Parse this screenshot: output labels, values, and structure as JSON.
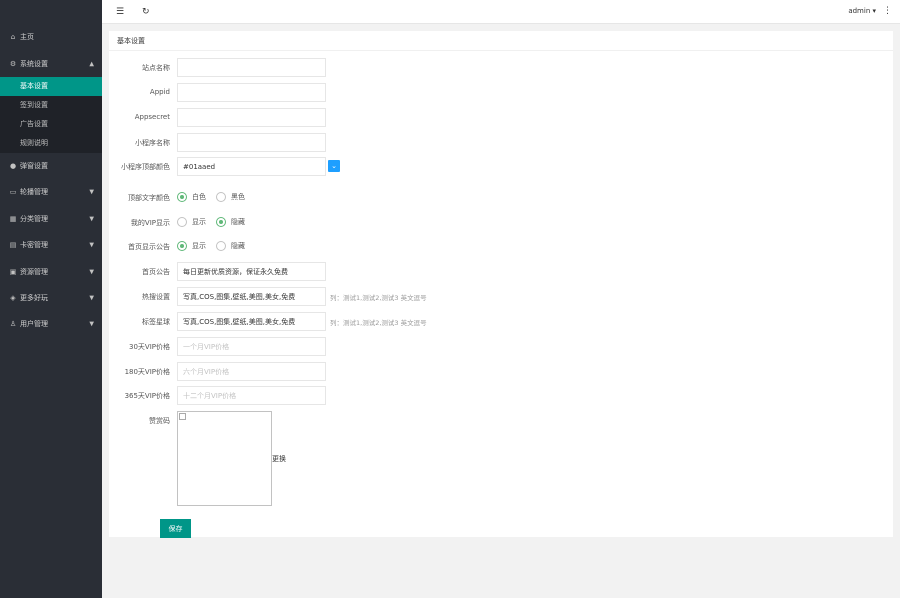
{
  "sidebar": {
    "items": [
      {
        "icon": "home-icon",
        "label": "主页",
        "arrow": ""
      },
      {
        "icon": "gear-icon",
        "label": "系统设置",
        "arrow": "▲"
      },
      {
        "icon": "circle-icon",
        "label": "弹窗设置",
        "arrow": ""
      },
      {
        "icon": "image-icon",
        "label": "轮播管理",
        "arrow": "▼"
      },
      {
        "icon": "category-icon",
        "label": "分类管理",
        "arrow": "▼"
      },
      {
        "icon": "card-icon",
        "label": "卡密管理",
        "arrow": "▼"
      },
      {
        "icon": "resource-icon",
        "label": "资源管理",
        "arrow": "▼"
      },
      {
        "icon": "more-icon",
        "label": "更多好玩",
        "arrow": "▼"
      },
      {
        "icon": "user-icon",
        "label": "用户管理",
        "arrow": "▼"
      }
    ],
    "subitems": [
      "基本设置",
      "签到设置",
      "广告设置",
      "规则说明"
    ]
  },
  "header": {
    "menu_icon": "☰",
    "refresh_icon": "↻",
    "user": "admin ▾",
    "more_icon": "⋮"
  },
  "card": {
    "title": "基本设置",
    "fields": {
      "site_name": {
        "label": "站点名称",
        "value": ""
      },
      "appid": {
        "label": "Appid",
        "value": ""
      },
      "appsecret": {
        "label": "Appsecret",
        "value": ""
      },
      "mini_name": {
        "label": "小程序名称",
        "value": ""
      },
      "top_color": {
        "label": "小程序顶部颜色",
        "value": "#01aaed",
        "color_picker_icon": "⌄"
      },
      "text_color": {
        "label": "顶部文字颜色",
        "options": [
          "白色",
          "黑色"
        ],
        "selected": 0
      },
      "vip_show": {
        "label": "我的VIP显示",
        "options": [
          "显示",
          "隐藏"
        ],
        "selected": 1
      },
      "notice_show": {
        "label": "首页显示公告",
        "options": [
          "显示",
          "隐藏"
        ],
        "selected": 0
      },
      "notice": {
        "label": "首页公告",
        "value": "每日更新优质资源，保证永久免费"
      },
      "hot_search": {
        "label": "热搜设置",
        "value": "写真,COS,图集,壁纸,美图,美女,免费",
        "hint": "列：测试1,测试2,测试3 英文逗号"
      },
      "tag_ball": {
        "label": "标签星球",
        "value": "写真,COS,图集,壁纸,美图,美女,免费",
        "hint": "列：测试1,测试2,测试3 英文逗号"
      },
      "vip30": {
        "label": "30天VIP价格",
        "placeholder": "一个月VIP价格"
      },
      "vip180": {
        "label": "180天VIP价格",
        "placeholder": "六个月VIP价格"
      },
      "vip365": {
        "label": "365天VIP价格",
        "placeholder": "十二个月VIP价格"
      },
      "reward_code": {
        "label": "赞赏码",
        "change": "更换"
      }
    },
    "save_label": "保存"
  },
  "colors": {
    "accent": "#009688",
    "sidebar": "#2a2e36",
    "radio": "#5fb878",
    "picker": "#1e9fff"
  }
}
